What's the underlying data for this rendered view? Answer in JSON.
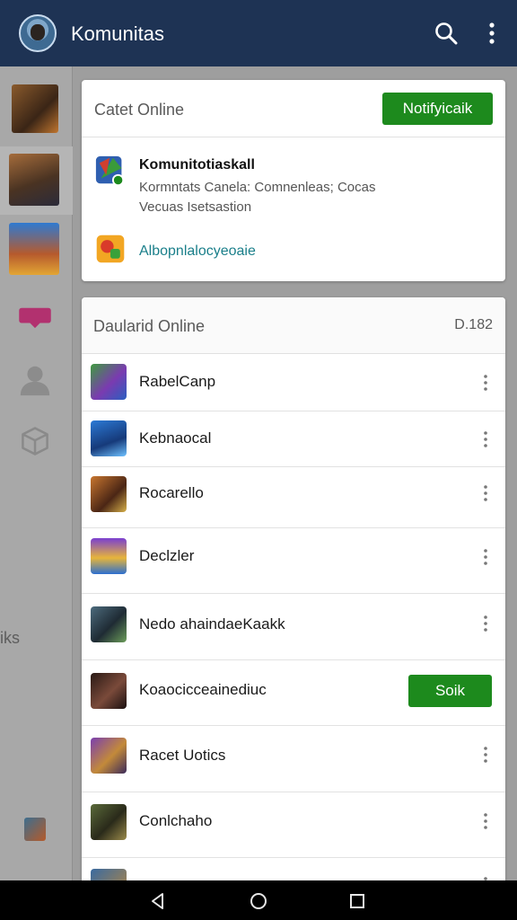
{
  "appbar": {
    "title": "Komunitas",
    "icons": [
      "avatar",
      "search-icon",
      "more-vert-icon"
    ]
  },
  "sidebar": {
    "caption": "iks",
    "icons": [
      "chat-icon",
      "person-icon",
      "cube-icon"
    ]
  },
  "notifications": {
    "header": "Catet Online",
    "action_label": "Notifyicaik",
    "item_title": "Komunitotiaskall",
    "item_line1": "Kormntats Canela: Comnenleas; Cocas",
    "item_line2": "Vecuas Isetsastion",
    "link_label": "Albopnlalocyeoaie"
  },
  "list": {
    "header": "Daularid Online",
    "count": "D.182",
    "rows": [
      {
        "name": "RabelCanp",
        "action": "more"
      },
      {
        "name": "Kebnaocal",
        "action": "more"
      },
      {
        "name": "Rocarello",
        "action": "more"
      },
      {
        "name": "Declzler",
        "action": "more"
      },
      {
        "name": "Nedo ahaindaeKaakk",
        "action": "more"
      },
      {
        "name": "Koaocicceainediuc",
        "action": "button",
        "button_label": "Soik"
      },
      {
        "name": "Racet Uotics",
        "action": "more"
      },
      {
        "name": "Conlchaho",
        "action": "more"
      },
      {
        "name": "",
        "action": "more"
      }
    ]
  },
  "navbar": {
    "icons": [
      "back-icon",
      "home-icon",
      "recents-icon"
    ]
  },
  "colors": {
    "appbar": "#1e3354",
    "accent_green": "#1d8a1d",
    "link": "#1a7f8a"
  }
}
